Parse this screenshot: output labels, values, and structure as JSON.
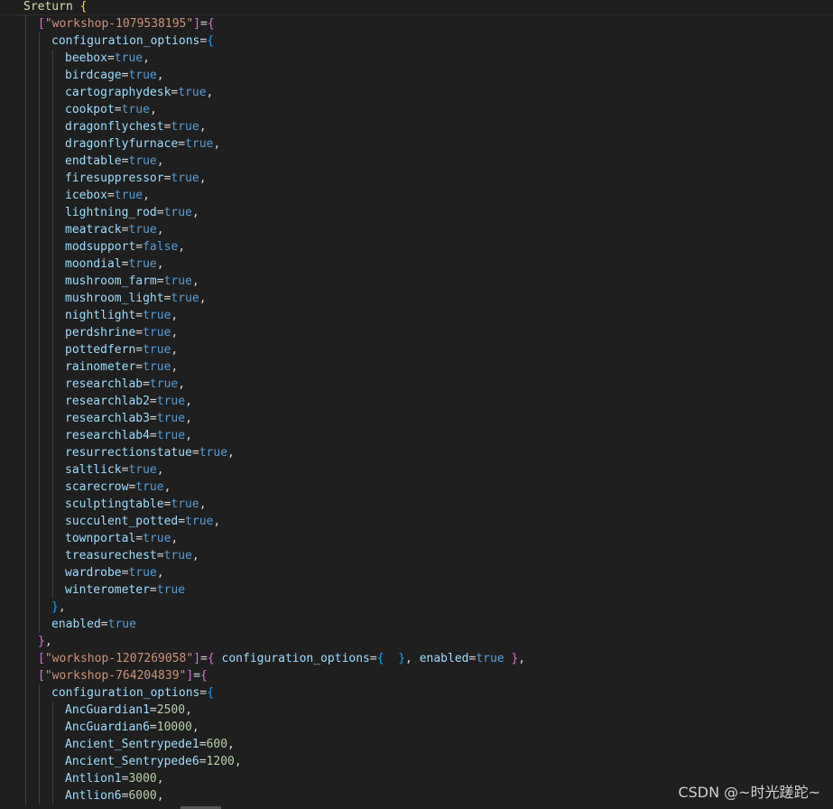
{
  "lines": [
    {
      "indent": 0,
      "segs": [
        [
          "kw",
          "Sreturn"
        ],
        [
          "punc",
          " "
        ],
        [
          "brace-y",
          "{"
        ]
      ]
    },
    {
      "indent": 1,
      "segs": [
        [
          "brace-p",
          "["
        ],
        [
          "str",
          "\"workshop-1079538195\""
        ],
        [
          "brace-p",
          "]"
        ],
        [
          "op",
          "="
        ],
        [
          "brace-p",
          "{"
        ]
      ]
    },
    {
      "indent": 2,
      "segs": [
        [
          "key",
          "configuration_options"
        ],
        [
          "op",
          "="
        ],
        [
          "brace-b",
          "{"
        ]
      ]
    },
    {
      "indent": 3,
      "segs": [
        [
          "key",
          "beebox"
        ],
        [
          "op",
          "="
        ],
        [
          "val",
          "true"
        ],
        [
          "punc",
          ","
        ]
      ]
    },
    {
      "indent": 3,
      "segs": [
        [
          "key",
          "birdcage"
        ],
        [
          "op",
          "="
        ],
        [
          "val",
          "true"
        ],
        [
          "punc",
          ","
        ]
      ]
    },
    {
      "indent": 3,
      "segs": [
        [
          "key",
          "cartographydesk"
        ],
        [
          "op",
          "="
        ],
        [
          "val",
          "true"
        ],
        [
          "punc",
          ","
        ]
      ]
    },
    {
      "indent": 3,
      "segs": [
        [
          "key",
          "cookpot"
        ],
        [
          "op",
          "="
        ],
        [
          "val",
          "true"
        ],
        [
          "punc",
          ","
        ]
      ]
    },
    {
      "indent": 3,
      "segs": [
        [
          "key",
          "dragonflychest"
        ],
        [
          "op",
          "="
        ],
        [
          "val",
          "true"
        ],
        [
          "punc",
          ","
        ]
      ]
    },
    {
      "indent": 3,
      "segs": [
        [
          "key",
          "dragonflyfurnace"
        ],
        [
          "op",
          "="
        ],
        [
          "val",
          "true"
        ],
        [
          "punc",
          ","
        ]
      ]
    },
    {
      "indent": 3,
      "segs": [
        [
          "key",
          "endtable"
        ],
        [
          "op",
          "="
        ],
        [
          "val",
          "true"
        ],
        [
          "punc",
          ","
        ]
      ]
    },
    {
      "indent": 3,
      "segs": [
        [
          "key",
          "firesuppressor"
        ],
        [
          "op",
          "="
        ],
        [
          "val",
          "true"
        ],
        [
          "punc",
          ","
        ]
      ]
    },
    {
      "indent": 3,
      "segs": [
        [
          "key",
          "icebox"
        ],
        [
          "op",
          "="
        ],
        [
          "val",
          "true"
        ],
        [
          "punc",
          ","
        ]
      ]
    },
    {
      "indent": 3,
      "segs": [
        [
          "key",
          "lightning_rod"
        ],
        [
          "op",
          "="
        ],
        [
          "val",
          "true"
        ],
        [
          "punc",
          ","
        ]
      ]
    },
    {
      "indent": 3,
      "segs": [
        [
          "key",
          "meatrack"
        ],
        [
          "op",
          "="
        ],
        [
          "val",
          "true"
        ],
        [
          "punc",
          ","
        ]
      ]
    },
    {
      "indent": 3,
      "segs": [
        [
          "key",
          "modsupport"
        ],
        [
          "op",
          "="
        ],
        [
          "val",
          "false"
        ],
        [
          "punc",
          ","
        ]
      ]
    },
    {
      "indent": 3,
      "segs": [
        [
          "key",
          "moondial"
        ],
        [
          "op",
          "="
        ],
        [
          "val",
          "true"
        ],
        [
          "punc",
          ","
        ]
      ]
    },
    {
      "indent": 3,
      "segs": [
        [
          "key",
          "mushroom_farm"
        ],
        [
          "op",
          "="
        ],
        [
          "val",
          "true"
        ],
        [
          "punc",
          ","
        ]
      ]
    },
    {
      "indent": 3,
      "segs": [
        [
          "key",
          "mushroom_light"
        ],
        [
          "op",
          "="
        ],
        [
          "val",
          "true"
        ],
        [
          "punc",
          ","
        ]
      ]
    },
    {
      "indent": 3,
      "segs": [
        [
          "key",
          "nightlight"
        ],
        [
          "op",
          "="
        ],
        [
          "val",
          "true"
        ],
        [
          "punc",
          ","
        ]
      ]
    },
    {
      "indent": 3,
      "segs": [
        [
          "key",
          "perdshrine"
        ],
        [
          "op",
          "="
        ],
        [
          "val",
          "true"
        ],
        [
          "punc",
          ","
        ]
      ]
    },
    {
      "indent": 3,
      "segs": [
        [
          "key",
          "pottedfern"
        ],
        [
          "op",
          "="
        ],
        [
          "val",
          "true"
        ],
        [
          "punc",
          ","
        ]
      ]
    },
    {
      "indent": 3,
      "segs": [
        [
          "key",
          "rainometer"
        ],
        [
          "op",
          "="
        ],
        [
          "val",
          "true"
        ],
        [
          "punc",
          ","
        ]
      ]
    },
    {
      "indent": 3,
      "segs": [
        [
          "key",
          "researchlab"
        ],
        [
          "op",
          "="
        ],
        [
          "val",
          "true"
        ],
        [
          "punc",
          ","
        ]
      ]
    },
    {
      "indent": 3,
      "segs": [
        [
          "key",
          "researchlab2"
        ],
        [
          "op",
          "="
        ],
        [
          "val",
          "true"
        ],
        [
          "punc",
          ","
        ]
      ]
    },
    {
      "indent": 3,
      "segs": [
        [
          "key",
          "researchlab3"
        ],
        [
          "op",
          "="
        ],
        [
          "val",
          "true"
        ],
        [
          "punc",
          ","
        ]
      ]
    },
    {
      "indent": 3,
      "segs": [
        [
          "key",
          "researchlab4"
        ],
        [
          "op",
          "="
        ],
        [
          "val",
          "true"
        ],
        [
          "punc",
          ","
        ]
      ]
    },
    {
      "indent": 3,
      "segs": [
        [
          "key",
          "resurrectionstatue"
        ],
        [
          "op",
          "="
        ],
        [
          "val",
          "true"
        ],
        [
          "punc",
          ","
        ]
      ]
    },
    {
      "indent": 3,
      "segs": [
        [
          "key",
          "saltlick"
        ],
        [
          "op",
          "="
        ],
        [
          "val",
          "true"
        ],
        [
          "punc",
          ","
        ]
      ]
    },
    {
      "indent": 3,
      "segs": [
        [
          "key",
          "scarecrow"
        ],
        [
          "op",
          "="
        ],
        [
          "val",
          "true"
        ],
        [
          "punc",
          ","
        ]
      ]
    },
    {
      "indent": 3,
      "segs": [
        [
          "key",
          "sculptingtable"
        ],
        [
          "op",
          "="
        ],
        [
          "val",
          "true"
        ],
        [
          "punc",
          ","
        ]
      ]
    },
    {
      "indent": 3,
      "segs": [
        [
          "key",
          "succulent_potted"
        ],
        [
          "op",
          "="
        ],
        [
          "val",
          "true"
        ],
        [
          "punc",
          ","
        ]
      ]
    },
    {
      "indent": 3,
      "segs": [
        [
          "key",
          "townportal"
        ],
        [
          "op",
          "="
        ],
        [
          "val",
          "true"
        ],
        [
          "punc",
          ","
        ]
      ]
    },
    {
      "indent": 3,
      "segs": [
        [
          "key",
          "treasurechest"
        ],
        [
          "op",
          "="
        ],
        [
          "val",
          "true"
        ],
        [
          "punc",
          ","
        ]
      ]
    },
    {
      "indent": 3,
      "segs": [
        [
          "key",
          "wardrobe"
        ],
        [
          "op",
          "="
        ],
        [
          "val",
          "true"
        ],
        [
          "punc",
          ","
        ]
      ]
    },
    {
      "indent": 3,
      "segs": [
        [
          "key",
          "winterometer"
        ],
        [
          "op",
          "="
        ],
        [
          "val",
          "true"
        ]
      ]
    },
    {
      "indent": 2,
      "segs": [
        [
          "brace-b",
          "}"
        ],
        [
          "punc",
          ","
        ]
      ]
    },
    {
      "indent": 2,
      "segs": [
        [
          "key",
          "enabled"
        ],
        [
          "op",
          "="
        ],
        [
          "val",
          "true"
        ]
      ]
    },
    {
      "indent": 1,
      "segs": [
        [
          "brace-p",
          "}"
        ],
        [
          "punc",
          ","
        ]
      ]
    },
    {
      "indent": 1,
      "segs": [
        [
          "brace-p",
          "["
        ],
        [
          "str",
          "\"workshop-1207269058\""
        ],
        [
          "brace-p",
          "]"
        ],
        [
          "op",
          "="
        ],
        [
          "brace-p",
          "{"
        ],
        [
          "punc",
          " "
        ],
        [
          "key",
          "configuration_options"
        ],
        [
          "op",
          "="
        ],
        [
          "brace-b",
          "{"
        ],
        [
          "punc",
          "  "
        ],
        [
          "brace-b",
          "}"
        ],
        [
          "punc",
          ", "
        ],
        [
          "key",
          "enabled"
        ],
        [
          "op",
          "="
        ],
        [
          "val",
          "true"
        ],
        [
          "punc",
          " "
        ],
        [
          "brace-p",
          "}"
        ],
        [
          "punc",
          ","
        ]
      ]
    },
    {
      "indent": 1,
      "segs": [
        [
          "brace-p",
          "["
        ],
        [
          "str",
          "\"workshop-764204839\""
        ],
        [
          "brace-p",
          "]"
        ],
        [
          "op",
          "="
        ],
        [
          "brace-p",
          "{"
        ]
      ]
    },
    {
      "indent": 2,
      "segs": [
        [
          "key",
          "configuration_options"
        ],
        [
          "op",
          "="
        ],
        [
          "brace-b",
          "{"
        ]
      ]
    },
    {
      "indent": 3,
      "segs": [
        [
          "key",
          "AncGuardian1"
        ],
        [
          "op",
          "="
        ],
        [
          "num",
          "2500"
        ],
        [
          "punc",
          ","
        ]
      ]
    },
    {
      "indent": 3,
      "segs": [
        [
          "key",
          "AncGuardian6"
        ],
        [
          "op",
          "="
        ],
        [
          "num",
          "10000"
        ],
        [
          "punc",
          ","
        ]
      ]
    },
    {
      "indent": 3,
      "segs": [
        [
          "key",
          "Ancient_Sentrypede1"
        ],
        [
          "op",
          "="
        ],
        [
          "num",
          "600"
        ],
        [
          "punc",
          ","
        ]
      ]
    },
    {
      "indent": 3,
      "segs": [
        [
          "key",
          "Ancient_Sentrypede6"
        ],
        [
          "op",
          "="
        ],
        [
          "num",
          "1200"
        ],
        [
          "punc",
          ","
        ]
      ]
    },
    {
      "indent": 3,
      "segs": [
        [
          "key",
          "Antlion1"
        ],
        [
          "op",
          "="
        ],
        [
          "num",
          "3000"
        ],
        [
          "punc",
          ","
        ]
      ]
    },
    {
      "indent": 3,
      "segs": [
        [
          "key",
          "Antlion6"
        ],
        [
          "op",
          "="
        ],
        [
          "num",
          "6000"
        ],
        [
          "punc",
          ","
        ]
      ]
    }
  ],
  "watermark": "CSDN @~时光蹉跎~"
}
